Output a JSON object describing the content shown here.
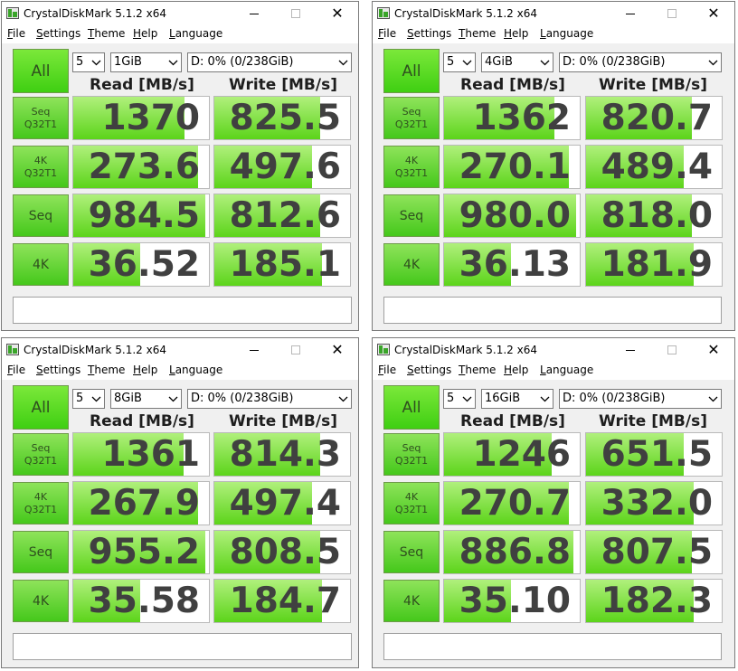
{
  "app": {
    "title": "CrystalDiskMark 5.1.2 x64",
    "menu": [
      "File",
      "Settings",
      "Theme",
      "Help",
      "Language"
    ],
    "all_button": "All",
    "read_header": "Read [MB/s]",
    "write_header": "Write [MB/s]",
    "close_glyph": "✕",
    "dropdown_icon": "chevron-down-icon",
    "colors": {
      "accent_green": "#45c81b",
      "bar_green_light": "#b0f07c",
      "number_text": "#404040"
    }
  },
  "windows": [
    {
      "count": "5",
      "size": "1GiB",
      "drive": "D: 0% (0/238GiB)",
      "rows": [
        {
          "label": [
            "Seq",
            "Q32T1"
          ],
          "read": "1370",
          "read_fill": 0.82,
          "write": "825.5",
          "write_fill": 0.78
        },
        {
          "label": [
            "4K",
            "Q32T1"
          ],
          "read": "273.6",
          "read_fill": 0.92,
          "write": "497.6",
          "write_fill": 0.72
        },
        {
          "label": [
            "Seq"
          ],
          "read": "984.5",
          "read_fill": 0.97,
          "write": "812.6",
          "write_fill": 0.78
        },
        {
          "label": [
            "4K"
          ],
          "read": "36.52",
          "read_fill": 0.49,
          "write": "185.1",
          "write_fill": 0.79
        }
      ]
    },
    {
      "count": "5",
      "size": "4GiB",
      "drive": "D: 0% (0/238GiB)",
      "rows": [
        {
          "label": [
            "Seq",
            "Q32T1"
          ],
          "read": "1362",
          "read_fill": 0.81,
          "write": "820.7",
          "write_fill": 0.78
        },
        {
          "label": [
            "4K",
            "Q32T1"
          ],
          "read": "270.1",
          "read_fill": 0.92,
          "write": "489.4",
          "write_fill": 0.72
        },
        {
          "label": [
            "Seq"
          ],
          "read": "980.0",
          "read_fill": 0.97,
          "write": "818.0",
          "write_fill": 0.78
        },
        {
          "label": [
            "4K"
          ],
          "read": "36.13",
          "read_fill": 0.49,
          "write": "181.9",
          "write_fill": 0.79
        }
      ]
    },
    {
      "count": "5",
      "size": "8GiB",
      "drive": "D: 0% (0/238GiB)",
      "rows": [
        {
          "label": [
            "Seq",
            "Q32T1"
          ],
          "read": "1361",
          "read_fill": 0.81,
          "write": "814.3",
          "write_fill": 0.78
        },
        {
          "label": [
            "4K",
            "Q32T1"
          ],
          "read": "267.9",
          "read_fill": 0.92,
          "write": "497.4",
          "write_fill": 0.72
        },
        {
          "label": [
            "Seq"
          ],
          "read": "955.2",
          "read_fill": 0.97,
          "write": "808.5",
          "write_fill": 0.78
        },
        {
          "label": [
            "4K"
          ],
          "read": "35.58",
          "read_fill": 0.49,
          "write": "184.7",
          "write_fill": 0.79
        }
      ]
    },
    {
      "count": "5",
      "size": "16GiB",
      "drive": "D: 0% (0/238GiB)",
      "rows": [
        {
          "label": [
            "Seq",
            "Q32T1"
          ],
          "read": "1246",
          "read_fill": 0.79,
          "write": "651.5",
          "write_fill": 0.72
        },
        {
          "label": [
            "4K",
            "Q32T1"
          ],
          "read": "270.7",
          "read_fill": 0.92,
          "write": "332.0",
          "write_fill": 0.79
        },
        {
          "label": [
            "Seq"
          ],
          "read": "886.8",
          "read_fill": 0.95,
          "write": "807.5",
          "write_fill": 0.78
        },
        {
          "label": [
            "4K"
          ],
          "read": "35.10",
          "read_fill": 0.49,
          "write": "182.3",
          "write_fill": 0.79
        }
      ]
    }
  ]
}
